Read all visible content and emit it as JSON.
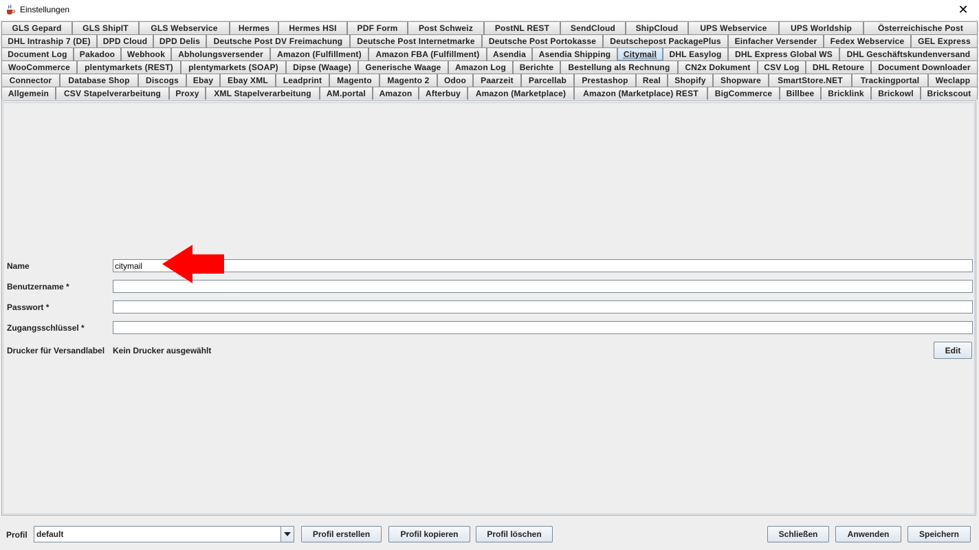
{
  "window": {
    "title": "Einstellungen",
    "close_glyph": "✕",
    "icon": "java-coffee-icon"
  },
  "tabs": {
    "rows": [
      [
        "GLS Gepard",
        "GLS ShipIT",
        "GLS Webservice",
        "Hermes",
        "Hermes HSI",
        "PDF Form",
        "Post Schweiz",
        "PostNL REST",
        "SendCloud",
        "ShipCloud",
        "UPS Webservice",
        "UPS Worldship",
        "Österreichische Post"
      ],
      [
        "DHL Intraship 7 (DE)",
        "DPD Cloud",
        "DPD Delis",
        "Deutsche Post DV Freimachung",
        "Deutsche Post Internetmarke",
        "Deutsche Post Portokasse",
        "Deutschepost PackagePlus",
        "Einfacher Versender",
        "Fedex Webservice",
        "GEL Express"
      ],
      [
        "Document Log",
        "Pakadoo",
        "Webhook",
        "Abholungsversender",
        "Amazon (Fulfillment)",
        "Amazon FBA (Fulfillment)",
        "Asendia",
        "Asendia Shipping",
        "Citymail",
        "DHL Easylog",
        "DHL Express Global WS",
        "DHL Geschäftskundenversand"
      ],
      [
        "WooCommerce",
        "plentymarkets (REST)",
        "plentymarkets (SOAP)",
        "Dipse (Waage)",
        "Generische Waage",
        "Amazon Log",
        "Berichte",
        "Bestellung als Rechnung",
        "CN2x Dokument",
        "CSV Log",
        "DHL Retoure",
        "Document Downloader"
      ],
      [
        "Connector",
        "Database Shop",
        "Discogs",
        "Ebay",
        "Ebay XML",
        "Leadprint",
        "Magento",
        "Magento 2",
        "Odoo",
        "Paarzeit",
        "Parcellab",
        "Prestashop",
        "Real",
        "Shopify",
        "Shopware",
        "SmartStore.NET",
        "Trackingportal",
        "Weclapp"
      ],
      [
        "Allgemein",
        "CSV Stapelverarbeitung",
        "Proxy",
        "XML Stapelverarbeitung",
        "AM.portal",
        "Amazon",
        "Afterbuy",
        "Amazon (Marketplace)",
        "Amazon (Marketplace) REST",
        "BigCommerce",
        "Billbee",
        "Bricklink",
        "Brickowl",
        "Brickscout"
      ]
    ],
    "selected": "Citymail"
  },
  "form": {
    "name_label": "Name",
    "name_value": "citymail",
    "username_label": "Benutzername *",
    "username_value": "",
    "password_label": "Passwort *",
    "password_value": "",
    "access_key_label": "Zugangsschlüssel *",
    "access_key_value": "",
    "printer_label": "Drucker für Versandlabel",
    "printer_value": "Kein Drucker ausgewählt",
    "edit_button": "Edit"
  },
  "annotation": {
    "arrow_color": "#ff0000"
  },
  "footer": {
    "profile_label": "Profil",
    "profile_value": "default",
    "create_profile": "Profil erstellen",
    "copy_profile": "Profil kopieren",
    "delete_profile": "Profil löschen",
    "close": "Schließen",
    "apply": "Anwenden",
    "save": "Speichern"
  }
}
